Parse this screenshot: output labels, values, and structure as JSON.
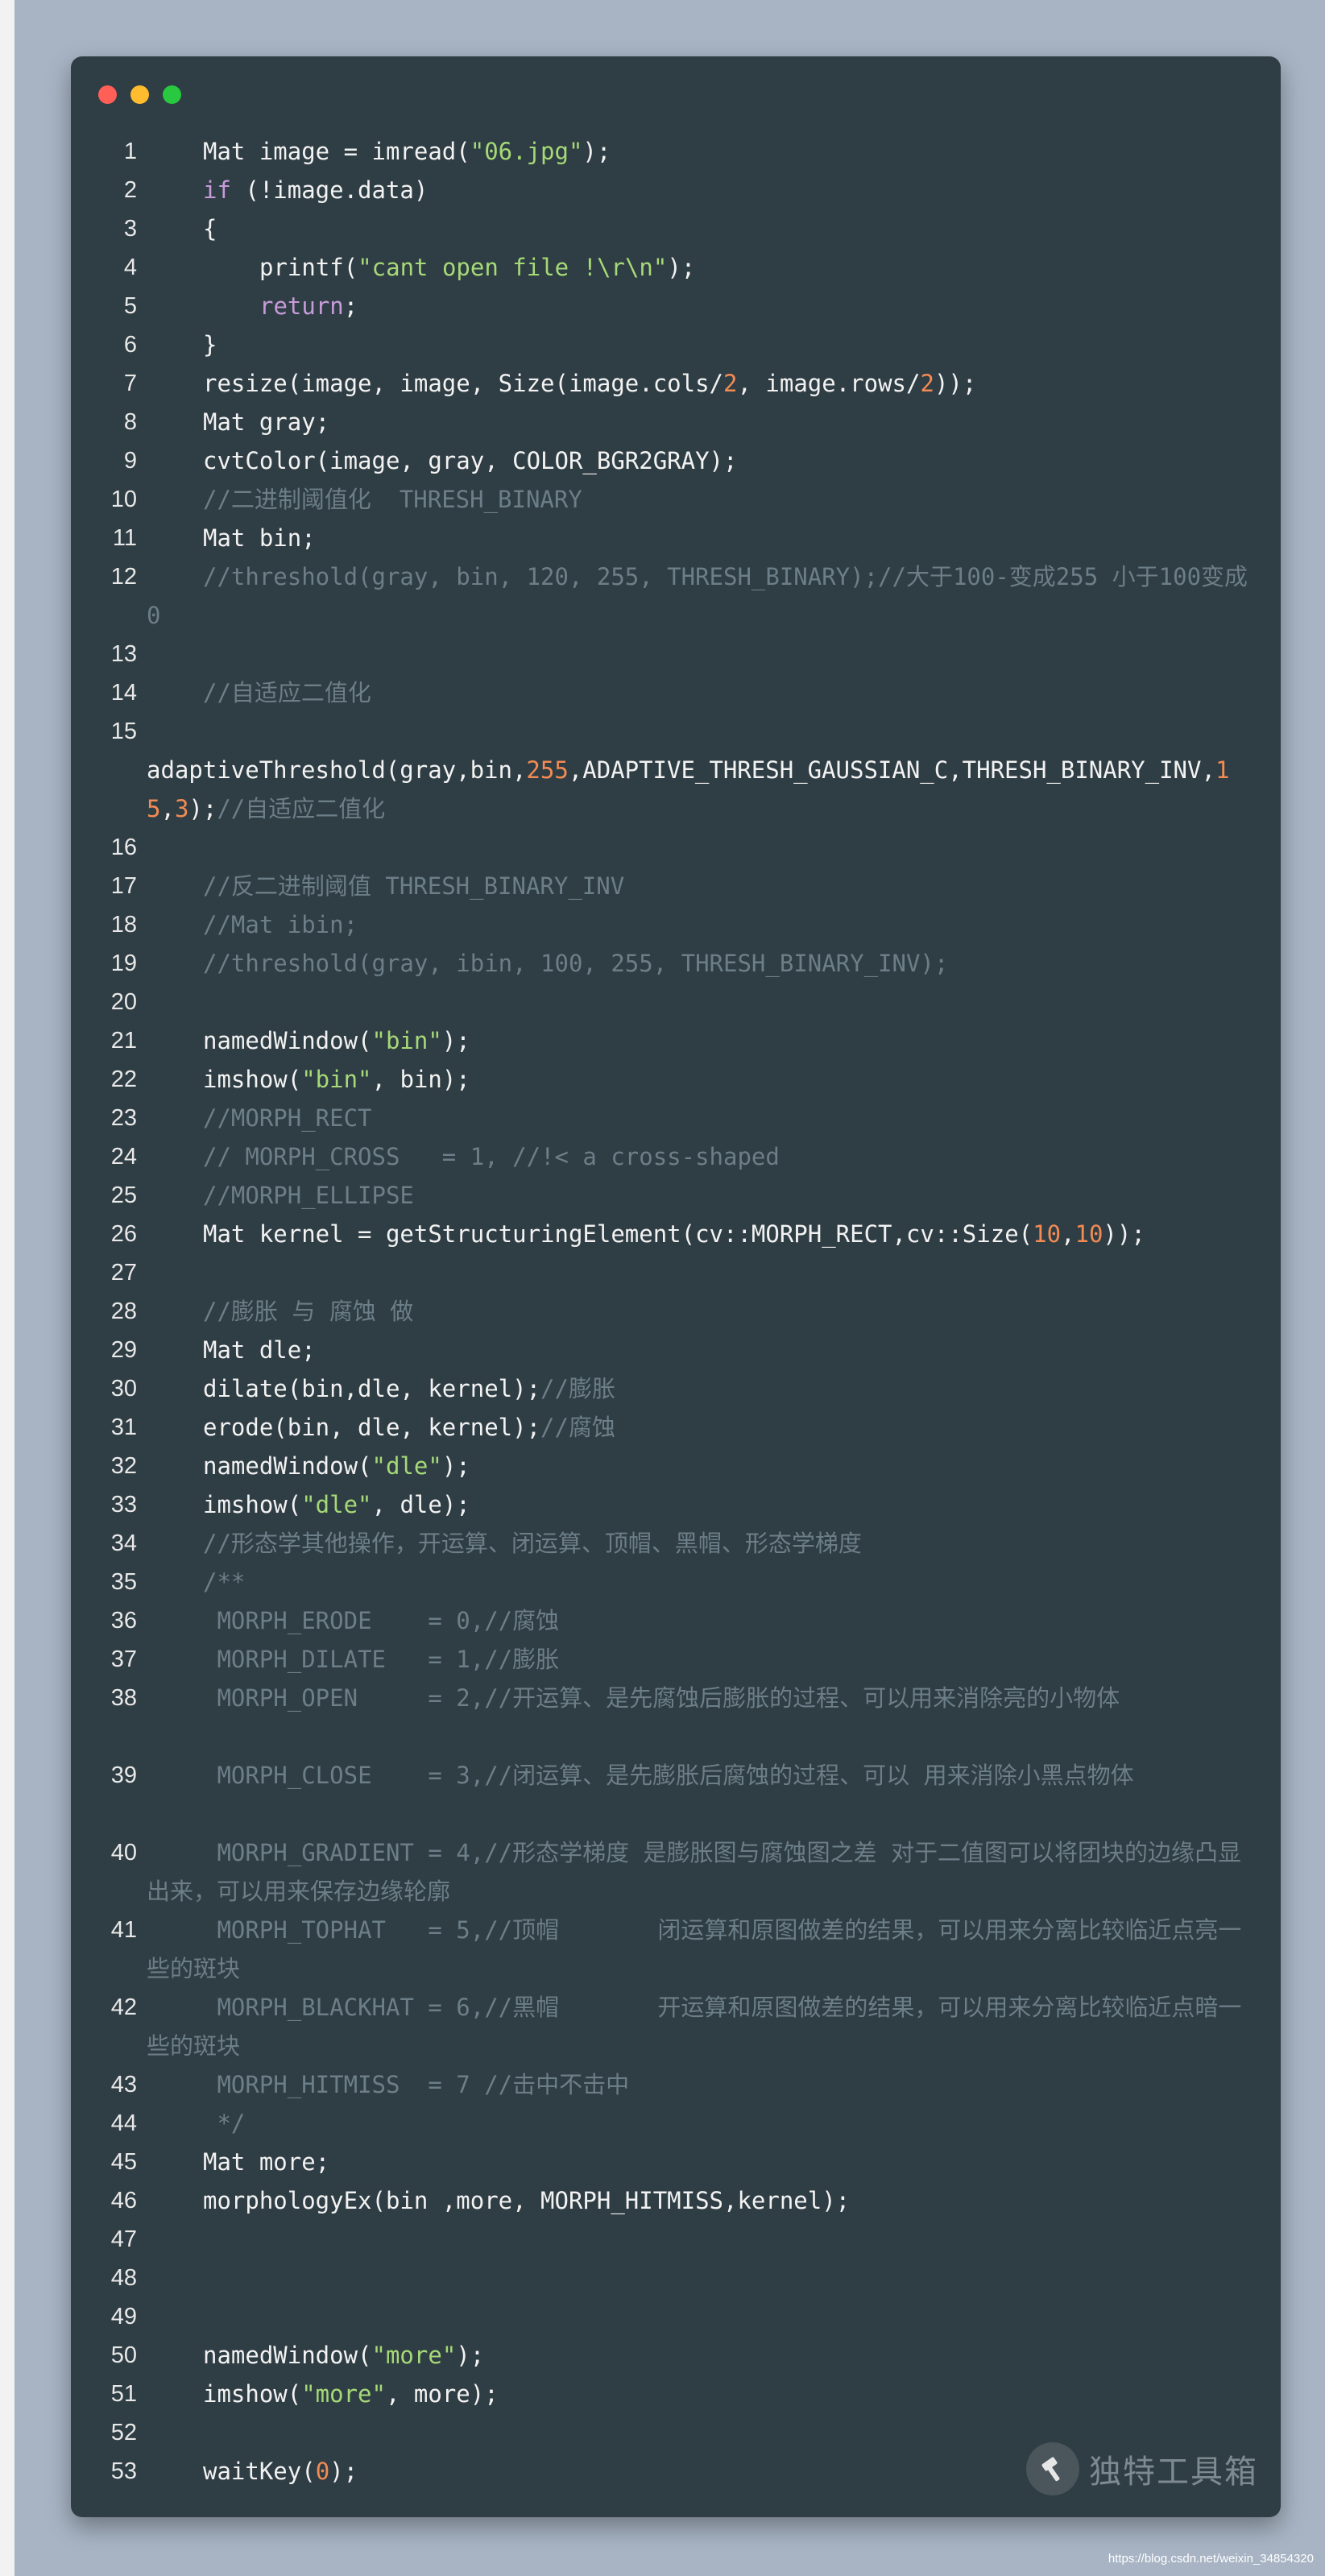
{
  "colors": {
    "background": "#a8b4c4",
    "window": "#2f3d44",
    "text": "#f2f2f2",
    "string": "#a6d977",
    "keyword": "#c79bd9",
    "number": "#f28b54",
    "comment": "#6c7e87"
  },
  "window_controls": [
    "close",
    "minimize",
    "maximize"
  ],
  "code_lines": [
    {
      "n": "1",
      "indent": 1,
      "parts": [
        [
          "normal",
          "Mat image = imread("
        ],
        [
          "string",
          "\"06.jpg\""
        ],
        [
          "normal",
          ");"
        ]
      ]
    },
    {
      "n": "2",
      "indent": 1,
      "parts": [
        [
          "keyword",
          "if"
        ],
        [
          "normal",
          " (!image.data)"
        ]
      ]
    },
    {
      "n": "3",
      "indent": 1,
      "parts": [
        [
          "normal",
          "{"
        ]
      ]
    },
    {
      "n": "4",
      "indent": 2,
      "parts": [
        [
          "normal",
          "printf("
        ],
        [
          "string",
          "\"cant open file !\\r\\n\""
        ],
        [
          "normal",
          ");"
        ]
      ]
    },
    {
      "n": "5",
      "indent": 2,
      "parts": [
        [
          "keyword",
          "return"
        ],
        [
          "normal",
          ";"
        ]
      ]
    },
    {
      "n": "6",
      "indent": 1,
      "parts": [
        [
          "normal",
          "}"
        ]
      ]
    },
    {
      "n": "7",
      "indent": 1,
      "parts": [
        [
          "normal",
          "resize(image, image, Size(image.cols/"
        ],
        [
          "number",
          "2"
        ],
        [
          "normal",
          ", image.rows/"
        ],
        [
          "number",
          "2"
        ],
        [
          "normal",
          "));"
        ]
      ]
    },
    {
      "n": "8",
      "indent": 1,
      "parts": [
        [
          "normal",
          "Mat gray;"
        ]
      ]
    },
    {
      "n": "9",
      "indent": 1,
      "parts": [
        [
          "normal",
          "cvtColor(image, gray, COLOR_BGR2GRAY);"
        ]
      ]
    },
    {
      "n": "10",
      "indent": 1,
      "parts": [
        [
          "comment",
          "//二进制阈值化  THRESH_BINARY"
        ]
      ]
    },
    {
      "n": "11",
      "indent": 1,
      "parts": [
        [
          "normal",
          "Mat bin;"
        ]
      ]
    },
    {
      "n": "12",
      "indent": 1,
      "rows": 2,
      "parts": [
        [
          "comment",
          "//threshold(gray, bin, 120, 255, THRESH_BINARY);//大于100-变成255 小于100变成0"
        ]
      ]
    },
    {
      "n": "13",
      "indent": 0,
      "parts": []
    },
    {
      "n": "14",
      "indent": 1,
      "parts": [
        [
          "comment",
          "//自适应二值化"
        ]
      ]
    },
    {
      "n": "15",
      "indent": 0,
      "rows": 3,
      "parts": [
        [
          "normal",
          "\nadaptiveThreshold(gray,bin,"
        ],
        [
          "number",
          "255"
        ],
        [
          "normal",
          ",ADAPTIVE_THRESH_GAUSSIAN_C,THRESH_BINARY_INV,"
        ],
        [
          "number",
          "15"
        ],
        [
          "normal",
          ","
        ],
        [
          "number",
          "3"
        ],
        [
          "normal",
          ");"
        ],
        [
          "comment",
          "//自适应二值化"
        ]
      ]
    },
    {
      "n": "16",
      "indent": 0,
      "parts": []
    },
    {
      "n": "17",
      "indent": 1,
      "parts": [
        [
          "comment",
          "//反二进制阈值 THRESH_BINARY_INV"
        ]
      ]
    },
    {
      "n": "18",
      "indent": 1,
      "parts": [
        [
          "comment",
          "//Mat ibin;"
        ]
      ]
    },
    {
      "n": "19",
      "indent": 1,
      "parts": [
        [
          "comment",
          "//threshold(gray, ibin, 100, 255, THRESH_BINARY_INV);"
        ]
      ]
    },
    {
      "n": "20",
      "indent": 0,
      "parts": []
    },
    {
      "n": "21",
      "indent": 1,
      "parts": [
        [
          "normal",
          "namedWindow("
        ],
        [
          "string",
          "\"bin\""
        ],
        [
          "normal",
          ");"
        ]
      ]
    },
    {
      "n": "22",
      "indent": 1,
      "parts": [
        [
          "normal",
          "imshow("
        ],
        [
          "string",
          "\"bin\""
        ],
        [
          "normal",
          ", bin);"
        ]
      ]
    },
    {
      "n": "23",
      "indent": 1,
      "parts": [
        [
          "comment",
          "//MORPH_RECT"
        ]
      ]
    },
    {
      "n": "24",
      "indent": 1,
      "parts": [
        [
          "comment",
          "// MORPH_CROSS   = 1, //!< a cross-shaped"
        ]
      ]
    },
    {
      "n": "25",
      "indent": 1,
      "parts": [
        [
          "comment",
          "//MORPH_ELLIPSE"
        ]
      ]
    },
    {
      "n": "26",
      "indent": 1,
      "parts": [
        [
          "normal",
          "Mat kernel = getStructuringElement(cv::MORPH_RECT,cv::Size("
        ],
        [
          "number",
          "10"
        ],
        [
          "normal",
          ","
        ],
        [
          "number",
          "10"
        ],
        [
          "normal",
          "));"
        ]
      ]
    },
    {
      "n": "27",
      "indent": 0,
      "parts": []
    },
    {
      "n": "28",
      "indent": 1,
      "parts": [
        [
          "comment",
          "//膨胀 与 腐蚀 做"
        ]
      ]
    },
    {
      "n": "29",
      "indent": 1,
      "parts": [
        [
          "normal",
          "Mat dle;"
        ]
      ]
    },
    {
      "n": "30",
      "indent": 1,
      "parts": [
        [
          "normal",
          "dilate(bin,dle, kernel);"
        ],
        [
          "comment",
          "//膨胀"
        ]
      ]
    },
    {
      "n": "31",
      "indent": 1,
      "parts": [
        [
          "normal",
          "erode(bin, dle, kernel);"
        ],
        [
          "comment",
          "//腐蚀"
        ]
      ]
    },
    {
      "n": "32",
      "indent": 1,
      "parts": [
        [
          "normal",
          "namedWindow("
        ],
        [
          "string",
          "\"dle\""
        ],
        [
          "normal",
          ");"
        ]
      ]
    },
    {
      "n": "33",
      "indent": 1,
      "parts": [
        [
          "normal",
          "imshow("
        ],
        [
          "string",
          "\"dle\""
        ],
        [
          "normal",
          ", dle);"
        ]
      ]
    },
    {
      "n": "34",
      "indent": 1,
      "parts": [
        [
          "comment",
          "//形态学其他操作，开运算、闭运算、顶帽、黑帽、形态学梯度"
        ]
      ]
    },
    {
      "n": "35",
      "indent": 1,
      "parts": [
        [
          "comment",
          "/**"
        ]
      ]
    },
    {
      "n": "36",
      "indent": 1,
      "parts": [
        [
          "comment",
          " MORPH_ERODE    = 0,//腐蚀"
        ]
      ]
    },
    {
      "n": "37",
      "indent": 1,
      "parts": [
        [
          "comment",
          " MORPH_DILATE   = 1,//膨胀"
        ]
      ]
    },
    {
      "n": "38",
      "indent": 1,
      "rows": 2,
      "parts": [
        [
          "comment",
          " MORPH_OPEN     = 2,//开运算、是先腐蚀后膨胀的过程、可以用来消除亮的小物体"
        ]
      ]
    },
    {
      "n": "39",
      "indent": 1,
      "rows": 2,
      "parts": [
        [
          "comment",
          " MORPH_CLOSE    = 3,//闭运算、是先膨胀后腐蚀的过程、可以 用来消除小黑点物体"
        ]
      ]
    },
    {
      "n": "40",
      "indent": 1,
      "rows": 2,
      "parts": [
        [
          "comment",
          " MORPH_GRADIENT = 4,//形态学梯度 是膨胀图与腐蚀图之差 对于二值图可以将团块的边缘凸显出来，可以用来保存边缘轮廓"
        ]
      ]
    },
    {
      "n": "41",
      "indent": 1,
      "rows": 2,
      "parts": [
        [
          "comment",
          " MORPH_TOPHAT   = 5,//顶帽       闭运算和原图做差的结果，可以用来分离比较临近点亮一些的斑块"
        ]
      ]
    },
    {
      "n": "42",
      "indent": 1,
      "rows": 2,
      "parts": [
        [
          "comment",
          " MORPH_BLACKHAT = 6,//黑帽       开运算和原图做差的结果，可以用来分离比较临近点暗一些的斑块"
        ]
      ]
    },
    {
      "n": "43",
      "indent": 1,
      "parts": [
        [
          "comment",
          " MORPH_HITMISS  = 7 //击中不击中"
        ]
      ]
    },
    {
      "n": "44",
      "indent": 1,
      "parts": [
        [
          "comment",
          " */"
        ]
      ]
    },
    {
      "n": "45",
      "indent": 1,
      "parts": [
        [
          "normal",
          "Mat more;"
        ]
      ]
    },
    {
      "n": "46",
      "indent": 1,
      "parts": [
        [
          "normal",
          "morphologyEx(bin ,more, MORPH_HITMISS,kernel);"
        ]
      ]
    },
    {
      "n": "47",
      "indent": 0,
      "parts": []
    },
    {
      "n": "48",
      "indent": 0,
      "parts": []
    },
    {
      "n": "49",
      "indent": 0,
      "parts": []
    },
    {
      "n": "50",
      "indent": 1,
      "parts": [
        [
          "normal",
          "namedWindow("
        ],
        [
          "string",
          "\"more\""
        ],
        [
          "normal",
          ");"
        ]
      ]
    },
    {
      "n": "51",
      "indent": 1,
      "parts": [
        [
          "normal",
          "imshow("
        ],
        [
          "string",
          "\"more\""
        ],
        [
          "normal",
          ", more);"
        ]
      ]
    },
    {
      "n": "52",
      "indent": 0,
      "parts": []
    },
    {
      "n": "53",
      "indent": 1,
      "parts": [
        [
          "normal",
          "waitKey("
        ],
        [
          "number",
          "0"
        ],
        [
          "normal",
          ");"
        ]
      ]
    }
  ],
  "watermark": {
    "text": "独特工具箱",
    "icon": "hammer-icon"
  },
  "url": "https://blog.csdn.net/weixin_34854320"
}
